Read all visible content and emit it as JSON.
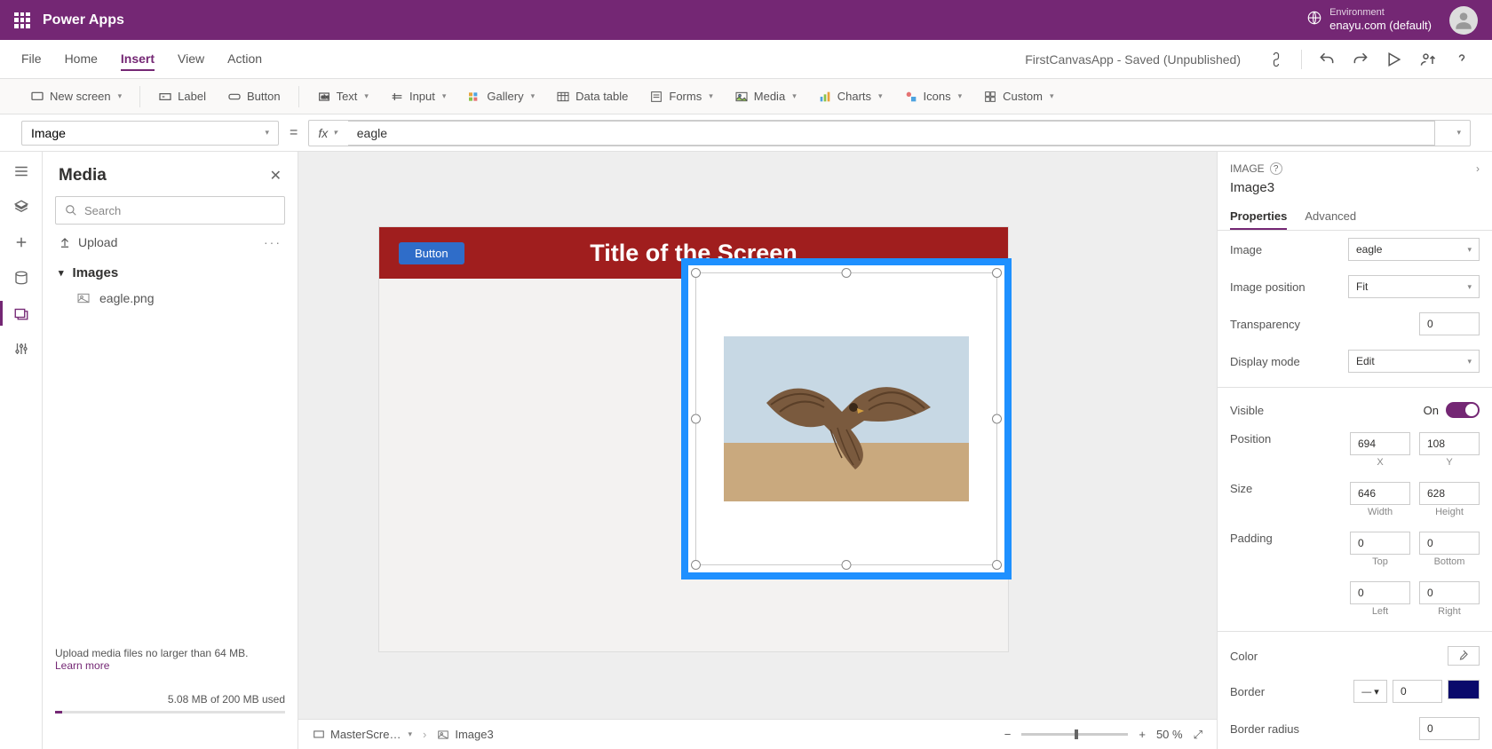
{
  "header": {
    "app_title": "Power Apps",
    "env_label": "Environment",
    "env_name": "enayu.com (default)"
  },
  "menu": {
    "items": [
      "File",
      "Home",
      "Insert",
      "View",
      "Action"
    ],
    "active_index": 2,
    "app_status": "FirstCanvasApp - Saved (Unpublished)"
  },
  "ribbon": {
    "new_screen": "New screen",
    "label": "Label",
    "button": "Button",
    "text": "Text",
    "input": "Input",
    "gallery": "Gallery",
    "data_table": "Data table",
    "forms": "Forms",
    "media": "Media",
    "charts": "Charts",
    "icons": "Icons",
    "custom": "Custom"
  },
  "formula": {
    "property": "Image",
    "value": "eagle"
  },
  "media_panel": {
    "title": "Media",
    "search_placeholder": "Search",
    "upload": "Upload",
    "images_header": "Images",
    "files": [
      "eagle.png"
    ],
    "footer_text": "Upload media files no larger than 64 MB.",
    "learn_more": "Learn more",
    "storage": "5.08 MB of 200 MB used"
  },
  "canvas": {
    "screen_title": "Title of the Screen",
    "button_label": "Button",
    "breadcrumb_screen": "MasterScre…",
    "breadcrumb_control": "Image3",
    "zoom": "50",
    "zoom_unit": "%"
  },
  "props": {
    "type": "IMAGE",
    "name": "Image3",
    "tabs": [
      "Properties",
      "Advanced"
    ],
    "image_label": "Image",
    "image_value": "eagle",
    "image_position_label": "Image position",
    "image_position_value": "Fit",
    "transparency_label": "Transparency",
    "transparency_value": "0",
    "display_mode_label": "Display mode",
    "display_mode_value": "Edit",
    "visible_label": "Visible",
    "visible_value": "On",
    "position_label": "Position",
    "position_x": "694",
    "position_y": "108",
    "x_label": "X",
    "y_label": "Y",
    "size_label": "Size",
    "size_w": "646",
    "size_h": "628",
    "w_label": "Width",
    "h_label": "Height",
    "padding_label": "Padding",
    "pad_top": "0",
    "pad_bottom": "0",
    "pad_left": "0",
    "pad_right": "0",
    "top_label": "Top",
    "bottom_label": "Bottom",
    "left_label": "Left",
    "right_label": "Right",
    "color_label": "Color",
    "border_label": "Border",
    "border_value": "0",
    "border_radius_label": "Border radius",
    "border_radius_value": "0"
  }
}
